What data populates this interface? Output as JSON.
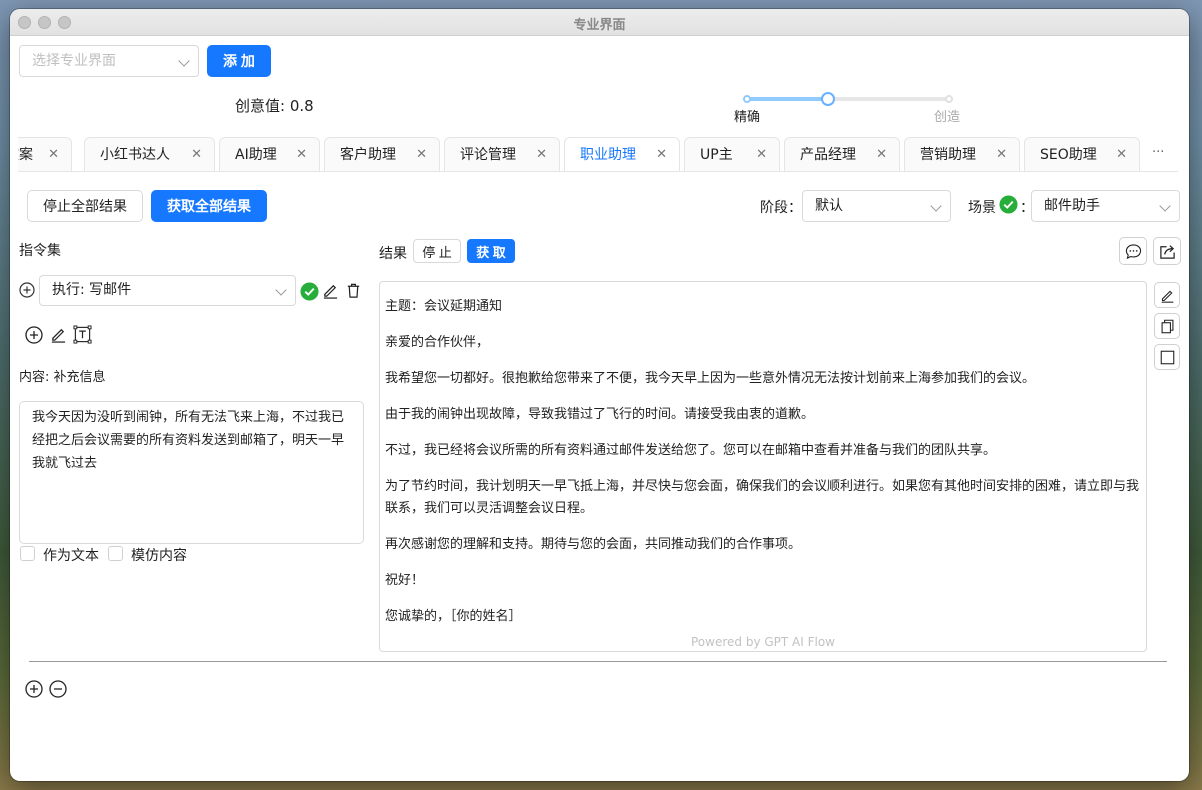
{
  "window": {
    "title": "专业界面"
  },
  "topbar": {
    "interface_select_placeholder": "选择专业界面",
    "add_label": "添 加",
    "creativity_label": "创意值: 0.8",
    "creativity_value": 0.8,
    "slider_left_label": "精确",
    "slider_right_label": "创造"
  },
  "tabs": [
    {
      "label": "文案",
      "active": false
    },
    {
      "label": "小红书达人",
      "active": false
    },
    {
      "label": "AI助理",
      "active": false
    },
    {
      "label": "客户助理",
      "active": false
    },
    {
      "label": "评论管理",
      "active": false
    },
    {
      "label": "职业助理",
      "active": true
    },
    {
      "label": "UP主",
      "active": false
    },
    {
      "label": "产品经理",
      "active": false
    },
    {
      "label": "营销助理",
      "active": false
    },
    {
      "label": "SEO助理",
      "active": false
    }
  ],
  "tabs_more": "···",
  "tab_close": "✕",
  "toolbar": {
    "stop_all_label": "停止全部结果",
    "get_all_label": "获取全部结果",
    "stage_label": "阶段：",
    "stage_value": "默认",
    "scene_label": "场景",
    "scene_colon": "：",
    "scene_value": "邮件助手"
  },
  "left": {
    "section_title": "指令集",
    "command_value": "执行: 写邮件",
    "content_label": "内容: 补充信息",
    "content_text": "我今天因为没听到闹钟，所有无法飞来上海，不过我已经把之后会议需要的所有资料发送到邮箱了，明天一早我就飞过去",
    "as_text_label": "作为文本",
    "imitate_label": "模仿内容"
  },
  "result": {
    "label": "结果",
    "stop_label": "停 止",
    "get_label": "获 取",
    "paragraphs": [
      "主题：会议延期通知",
      "亲爱的合作伙伴，",
      "我希望您一切都好。很抱歉给您带来了不便，我今天早上因为一些意外情况无法按计划前来上海参加我们的会议。",
      "由于我的闹钟出现故障，导致我错过了飞行的时间。请接受我由衷的道歉。",
      "不过，我已经将会议所需的所有资料通过邮件发送给您了。您可以在邮箱中查看并准备与我们的团队共享。",
      "为了节约时间，我计划明天一早飞抵上海，并尽快与您会面，确保我们的会议顺利进行。如果您有其他时间安排的困难，请立即与我联系，我们可以灵活调整会议日程。",
      "再次感谢您的理解和支持。期待与您的会面，共同推动我们的合作事项。",
      "祝好！",
      "您诚挚的，［你的姓名］"
    ],
    "powered_by": "Powered by GPT AI Flow"
  },
  "colors": {
    "primary": "#1677ff",
    "success": "#27ae3a",
    "slider": "#91caff"
  }
}
